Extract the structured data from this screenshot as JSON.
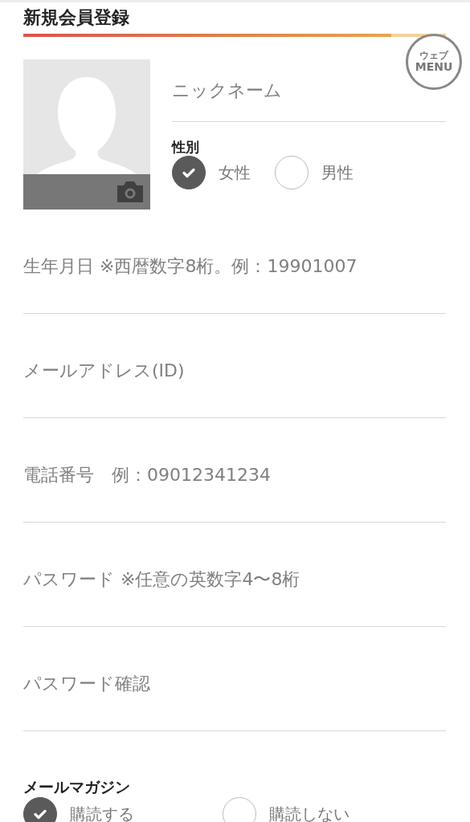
{
  "title": "新規会員登録",
  "menu_button": {
    "lines": [
      "ウェブ",
      "MENU"
    ]
  },
  "profile": {
    "photo": {
      "kind": "placeholder"
    },
    "nickname": {
      "placeholder": "ニックネーム"
    },
    "gender": {
      "label": "性別",
      "options": [
        {
          "label": "女性",
          "selected": true
        },
        {
          "label": "男性",
          "selected": false
        }
      ]
    }
  },
  "fields": [
    {
      "placeholder": "生年月日 ※西暦数字8桁。例：19901007"
    },
    {
      "placeholder": "メールアドレス(ID)"
    },
    {
      "placeholder": "電話番号　例：09012341234"
    },
    {
      "placeholder": "パスワード ※任意の英数字4〜8桁"
    },
    {
      "placeholder": "パスワード確認"
    }
  ],
  "newsletter": {
    "label": "メールマガジン",
    "options": [
      {
        "label": "購読する",
        "selected": true
      },
      {
        "label": "購読しない",
        "selected": false
      }
    ]
  }
}
